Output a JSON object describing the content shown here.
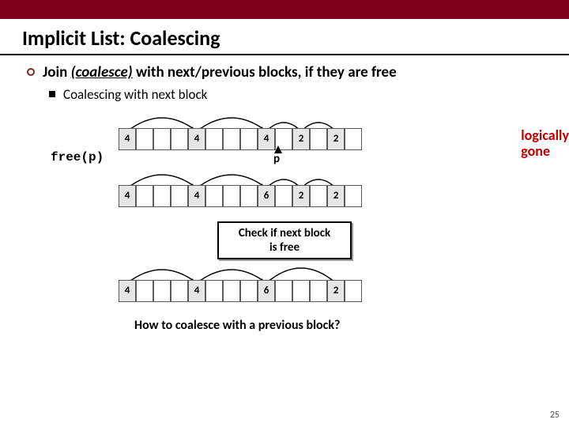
{
  "title": "Implicit List: Coalescing",
  "bullet1_pre": "Join ",
  "bullet1_underlined": "(coalesce)",
  "bullet1_post": " with next/previous blocks, if they are free",
  "bullet2": "Coalescing with next block",
  "free_label": "free(p)",
  "p_label": "p",
  "annotation_l1": "logically",
  "annotation_l2": "gone",
  "check_l1": "Check if next block",
  "check_l2": "is free",
  "question": "How to coalesce with a previous block?",
  "page": "25",
  "row1": [
    "4",
    "",
    "",
    "",
    "4",
    "",
    "",
    "",
    "4",
    "",
    "2",
    "",
    "2",
    ""
  ],
  "row2": [
    "4",
    "",
    "",
    "",
    "4",
    "",
    "",
    "",
    "6",
    "",
    "2",
    "",
    "2",
    ""
  ],
  "row3": [
    "4",
    "",
    "",
    "",
    "4",
    "",
    "",
    "",
    "6",
    "",
    "",
    "",
    "2",
    ""
  ]
}
